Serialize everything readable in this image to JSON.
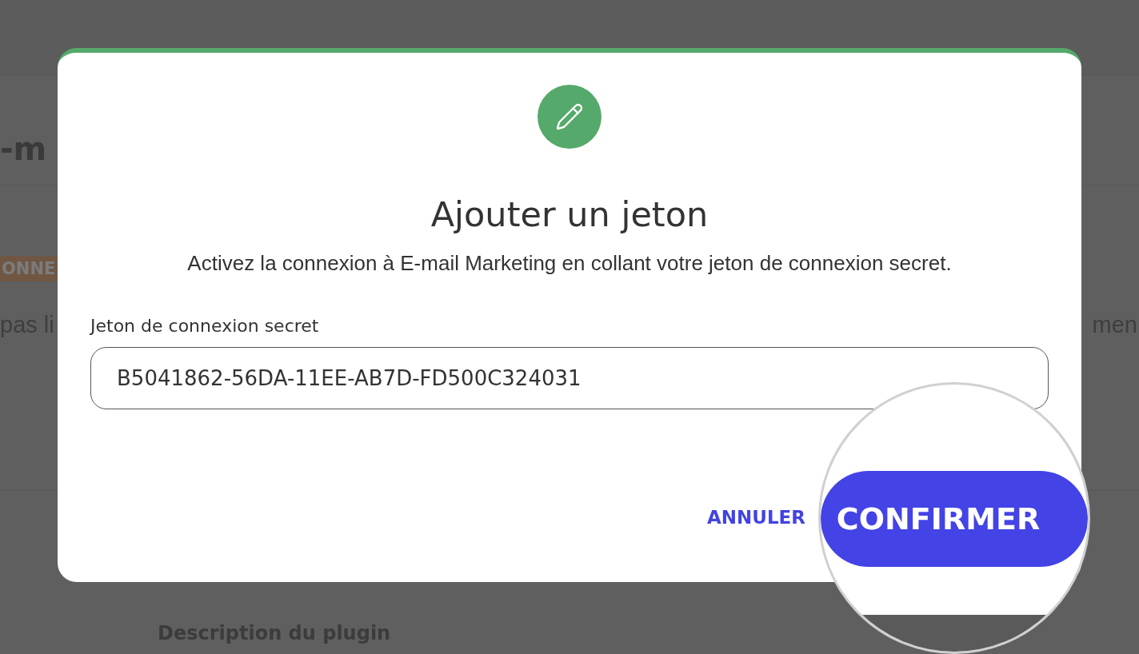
{
  "background": {
    "title": "-m",
    "badge": "ONNE",
    "notice_left": "pas li",
    "notice_right": "men",
    "section_heading": "Description du plugin"
  },
  "dialog": {
    "title": "Ajouter un jeton",
    "description": "Activez la connexion à E-mail Marketing en collant votre jeton de connexion secret.",
    "field": {
      "label": "Jeton de connexion secret",
      "value": "B5041862-56DA-11EE-AB7D-FD500C324031"
    },
    "buttons": [
      {
        "label": "ANNULER",
        "kind": "text",
        "magnified": false
      },
      {
        "label": "CONFIRMER",
        "kind": "primary",
        "magnified": true
      }
    ]
  }
}
